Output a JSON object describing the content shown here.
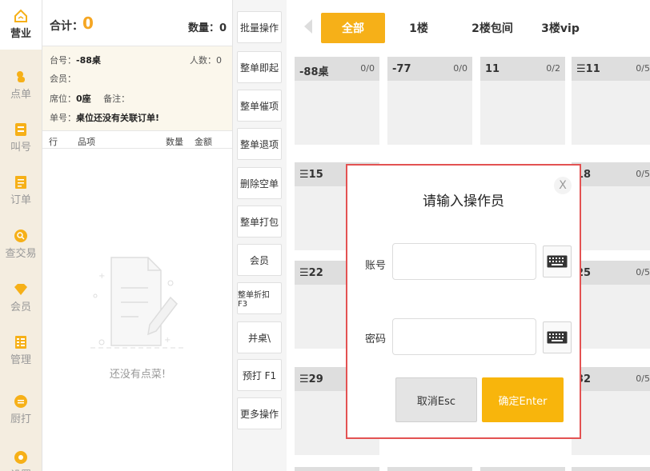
{
  "nav": {
    "items": [
      {
        "label": "营业",
        "icon": "home-icon"
      },
      {
        "label": "点单",
        "icon": "hand-icon"
      },
      {
        "label": "叫号",
        "icon": "ticket-icon"
      },
      {
        "label": "订单",
        "icon": "document-icon"
      },
      {
        "label": "查交易",
        "icon": "search-icon"
      },
      {
        "label": "会员",
        "icon": "diamond-icon"
      },
      {
        "label": "管理",
        "icon": "grid-icon"
      },
      {
        "label": "厨打",
        "icon": "printer-icon"
      },
      {
        "label": "设置",
        "icon": "gear-icon"
      }
    ],
    "active_color": "#f6b018"
  },
  "order": {
    "total_label": "合计：",
    "total_value": "0",
    "qty_label": "数量：0",
    "table_label": "台号：",
    "table_value": "-88桌",
    "people_label": "人数：0",
    "member_label": "会员：",
    "seat_label": "席位：",
    "seat_value": "0座",
    "note_label": "备注：",
    "bill_label": "单号：",
    "bill_value": "桌位还没有关联订单!",
    "columns": {
      "row": "行",
      "item": "品项",
      "qty": "数量",
      "amount": "金额"
    },
    "empty_text": "还没有点菜!"
  },
  "actions": [
    "批量操作",
    "整单即起",
    "整单催项",
    "整单退项",
    "删除空单",
    "整单打包",
    "会员",
    "整单折扣 F3",
    "并桌\\",
    "预打 F1",
    "更多操作"
  ],
  "tabs": [
    {
      "label": "全部",
      "active": true
    },
    {
      "label": "1楼",
      "active": false
    },
    {
      "label": "2楼包间",
      "active": false
    },
    {
      "label": "3楼vip",
      "active": false
    }
  ],
  "cards": [
    {
      "name": "-88桌",
      "count": "0/0"
    },
    {
      "name": "-77",
      "count": "0/0"
    },
    {
      "name": "11",
      "count": "0/2"
    },
    {
      "name": "☰11",
      "count": "0/5"
    },
    {
      "name": "☰15",
      "count": ""
    },
    {
      "name": "18",
      "count": "0/5"
    },
    {
      "name": "☰22",
      "count": ""
    },
    {
      "name": "25",
      "count": "0/5"
    },
    {
      "name": "☰29",
      "count": ""
    },
    {
      "name": "32",
      "count": "0/5"
    }
  ],
  "modal": {
    "title": "请输入操作员",
    "close": "X",
    "account_label": "账号",
    "password_label": "密码",
    "account_value": "",
    "password_value": "",
    "cancel": "取消Esc",
    "confirm": "确定Enter",
    "accent": "#f8b50c",
    "border_color": "#e35252"
  }
}
